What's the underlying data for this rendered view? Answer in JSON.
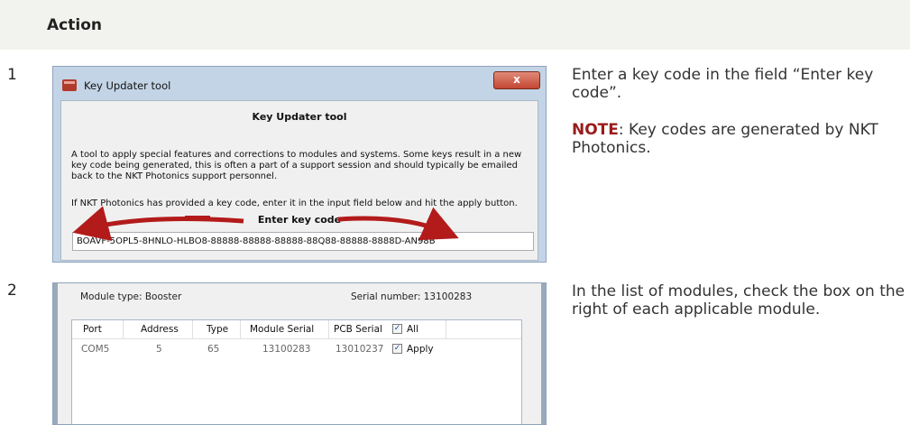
{
  "header": {
    "action_label": "Action"
  },
  "steps": [
    {
      "number": "1",
      "screenshot": {
        "window_title": "Key Updater tool",
        "close_glyph": "x",
        "heading": "Key Updater tool",
        "paragraph1": "A tool to apply special features and corrections to modules and systems. Some keys result in a new key code being generated, this is often a part of a support session and should typically be emailed back to the NKT Photonics support personnel.",
        "paragraph2": "If NKT Photonics has provided a key code, enter it in the input field below and hit the apply button.",
        "enter_label": "Enter key code",
        "key_value": "BOAVF-5OPL5-8HNLO-HLBO8-88888-88888-88888-88Q88-88888-8888D-AN98B"
      },
      "description": {
        "line1": "Enter a key code in the field “Enter key code”.",
        "note_label": "NOTE",
        "note_text": ": Key codes are generated by NKT Photonics."
      }
    },
    {
      "number": "2",
      "screenshot": {
        "module_type": "Module type: Booster",
        "serial_number": "Serial number: 13100283",
        "columns": [
          "Port",
          "Address",
          "Type",
          "Module Serial",
          "PCB Serial",
          "All"
        ],
        "row": {
          "port": "COM5",
          "address": "5",
          "type": "65",
          "module_serial": "13100283",
          "pcb_serial": "13010237",
          "apply_label": "Apply"
        },
        "all_checked": true,
        "apply_checked": true,
        "check_glyph": "✓"
      },
      "description": {
        "text": "In the list of modules, check the box on the right of each applicable module."
      }
    }
  ],
  "colors": {
    "header_band": "#f2f2ee",
    "note_accent": "#9a1b1b",
    "arrow": "#b31b1b"
  }
}
